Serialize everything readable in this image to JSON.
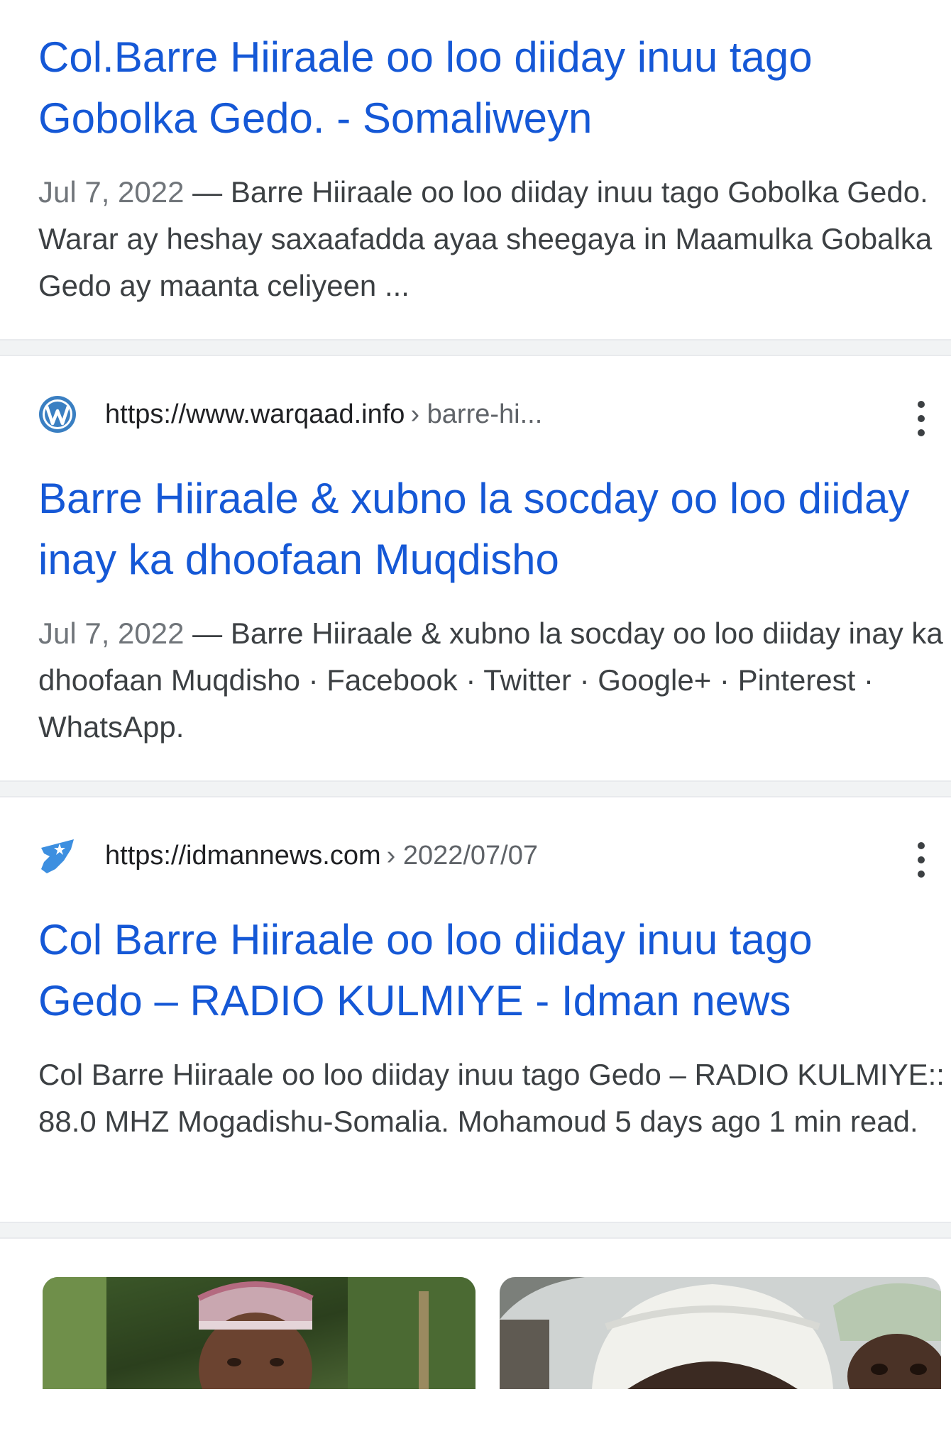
{
  "results": [
    {
      "title": "Col.Barre Hiiraale oo loo diiday inuu tago Gobolka Gedo. - Somaliweyn",
      "date": "Jul 7, 2022",
      "separator": " — ",
      "snippet": "Barre Hiiraale oo loo diiday inuu tago Gobolka Gedo. Warar ay heshay saxaafadda ayaa sheegaya in Maamulka Gobalka Gedo ay maanta celiyeen ..."
    },
    {
      "favicon": "wordpress-icon",
      "url": "https://www.warqaad.info",
      "path": "› barre-hi...",
      "title": "Barre Hiiraale & xubno la socday oo loo diiday inay ka dhoofaan Muqdisho",
      "date": "Jul 7, 2022",
      "separator": " — ",
      "snippet": "Barre Hiiraale & xubno la socday oo loo diiday inay ka dhoofaan Muqdisho · Facebook · Twitter · Google+ · Pinterest · WhatsApp."
    },
    {
      "favicon": "somalia-map-icon",
      "url": "https://idmannews.com",
      "path": "› 2022/07/07",
      "title": "Col Barre Hiiraale oo loo diiday inuu tago Gedo – RADIO KULMIYE - Idman news",
      "snippet": "Col Barre Hiiraale oo loo diiday inuu tago Gedo – RADIO KULMIYE:: 88.0 MHZ Mogadishu-Somalia. Mohamoud 5 days ago 1 min read."
    }
  ],
  "colors": {
    "link": "#1558d6",
    "snippet": "#3c4043",
    "date": "#70757a",
    "divider": "#f1f3f4"
  }
}
